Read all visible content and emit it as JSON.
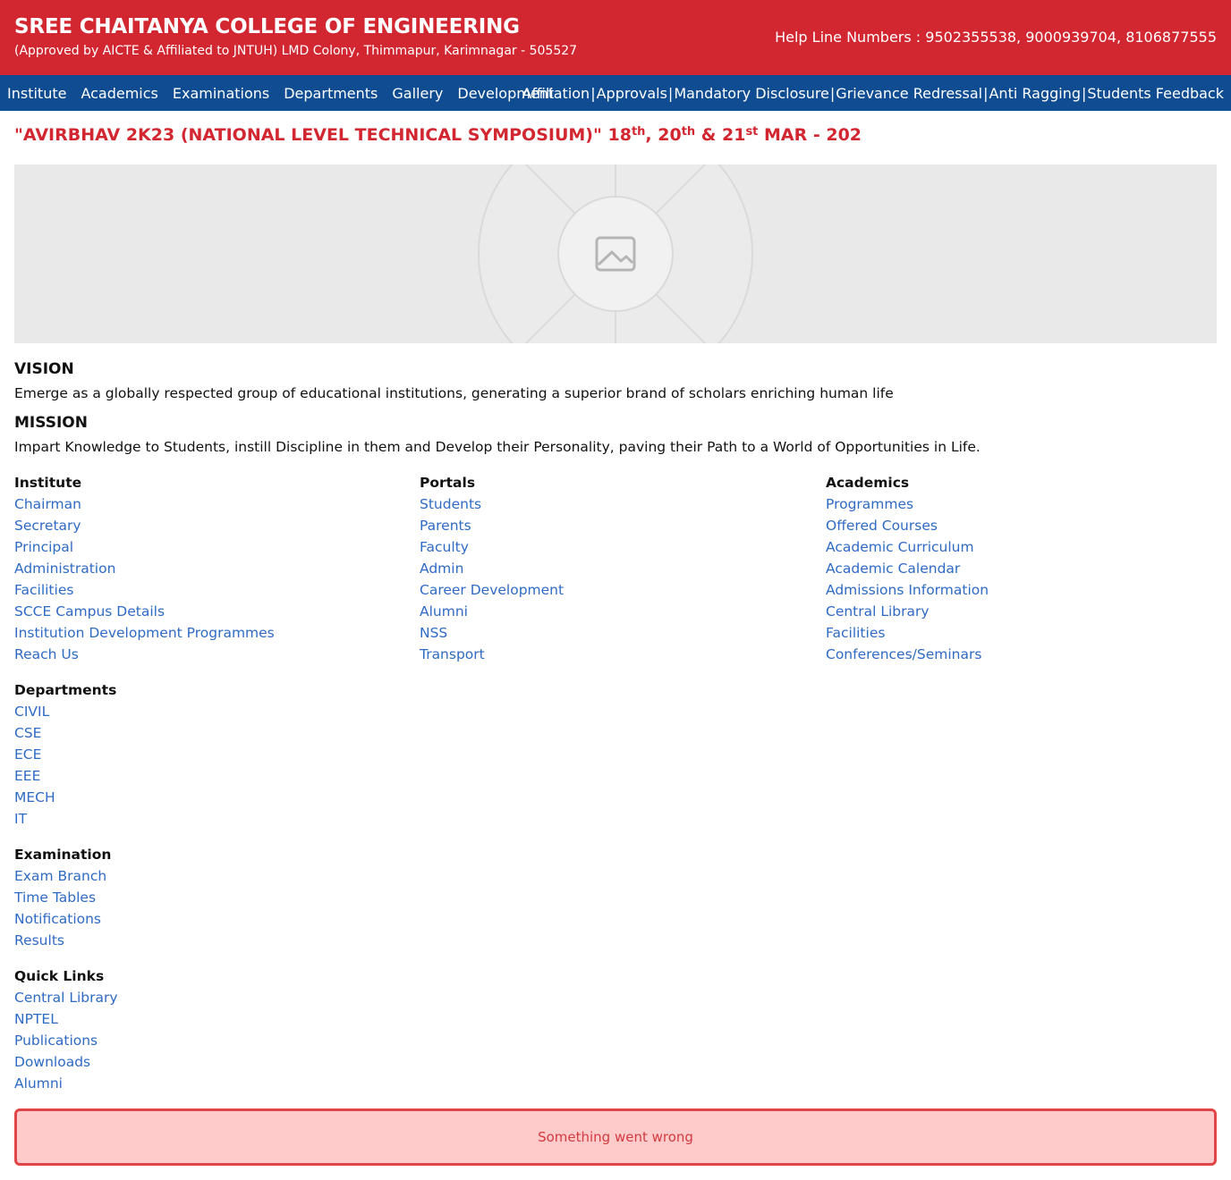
{
  "header": {
    "title": "SREE CHAITANYA COLLEGE OF ENGINEERING",
    "subtitle": "(Approved by AICTE & Affiliated to JNTUH) LMD Colony, Thimmapur, Karimnagar - 505527",
    "helpline": "Help Line Numbers : 9502355538, 9000939704, 8106877555",
    "bg_color": "#d22630"
  },
  "nav": {
    "left": [
      "Institute",
      "Academics",
      "Examinations",
      "Departments",
      "Gallery",
      "Development"
    ],
    "right": [
      "Affiliation",
      "Approvals",
      "Mandatory Disclosure",
      "Grievance Redressal",
      "Anti Ragging",
      "Students Feedback"
    ],
    "separator": "|",
    "bg_color": "#0f4c92"
  },
  "event": {
    "prefix": "\"AVIRBHAV 2K23 (NATIONAL LEVEL TECHNICAL SYMPOSIUM)\" 18",
    "sup1": "th",
    "mid1": ", 20",
    "sup2": "th",
    "mid2": " & 21",
    "sup3": "st",
    "suffix": " MAR - 202"
  },
  "banner": {
    "icon": "image-placeholder-icon"
  },
  "vision": {
    "heading": "VISION",
    "text": "Emerge as a globally respected group of educational institutions, generating a superior brand of scholars enriching human life"
  },
  "mission": {
    "heading": "MISSION",
    "text": "Impart Knowledge to Students, instill Discipline in them and Develop their Personality, paving their Path to a World of Opportunities in Life."
  },
  "footer_links": {
    "institute": {
      "title": "Institute",
      "items": [
        "Chairman",
        "Secretary",
        "Principal",
        "Administration",
        "Facilities",
        "SCCE Campus Details",
        "Institution Development Programmes",
        "Reach Us"
      ]
    },
    "portals": {
      "title": "Portals",
      "items": [
        "Students",
        "Parents",
        "Faculty",
        "Admin",
        "Career Development",
        "Alumni",
        "NSS",
        "Transport"
      ]
    },
    "academics": {
      "title": "Academics",
      "items": [
        "Programmes",
        "Offered Courses",
        "Academic Curriculum",
        "Academic Calendar",
        "Admissions Information",
        "Central Library",
        "Facilities",
        "Conferences/Seminars"
      ]
    },
    "departments": {
      "title": "Departments",
      "items": [
        "CIVIL",
        "CSE",
        "ECE",
        "EEE",
        "MECH",
        "IT"
      ]
    },
    "examination": {
      "title": "Examination",
      "items": [
        "Exam Branch",
        "Time Tables",
        "Notifications",
        "Results"
      ]
    },
    "quick_links": {
      "title": "Quick Links",
      "items": [
        "Central Library",
        "NPTEL",
        "Publications",
        "Downloads",
        "Alumni"
      ]
    }
  },
  "error": {
    "message": "Something went wrong",
    "bg_color": "#fecaca",
    "border_color": "#e0454a"
  },
  "link_color": "#2f6bc4"
}
